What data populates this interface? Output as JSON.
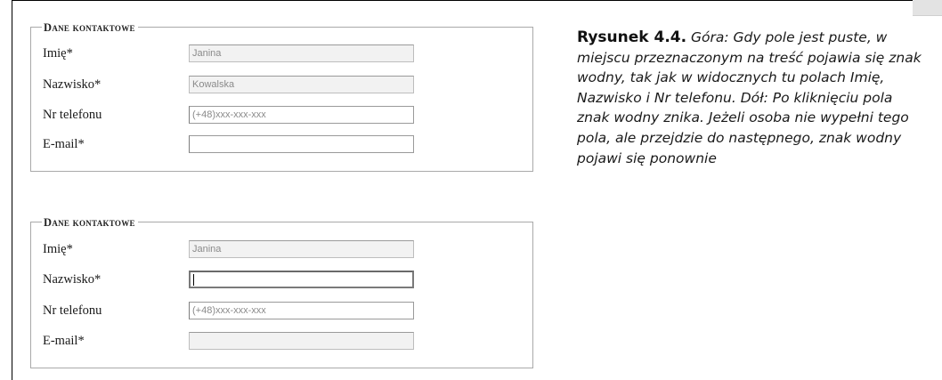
{
  "forms": [
    {
      "legend": "Dane kontaktowe",
      "fields": [
        {
          "label": "Imię*",
          "value": "Janina",
          "state": "watermark"
        },
        {
          "label": "Nazwisko*",
          "value": "Kowalska",
          "state": "watermark"
        },
        {
          "label": "Nr telefonu",
          "value": "(+48)xxx-xxx-xxx",
          "state": "watermark"
        },
        {
          "label": "E-mail*",
          "value": "",
          "state": "empty"
        }
      ]
    },
    {
      "legend": "Dane kontaktowe",
      "fields": [
        {
          "label": "Imię*",
          "value": "Janina",
          "state": "watermark"
        },
        {
          "label": "Nazwisko*",
          "value": "",
          "state": "focused"
        },
        {
          "label": "Nr telefonu",
          "value": "(+48)xxx-xxx-xxx",
          "state": "watermark"
        },
        {
          "label": "E-mail*",
          "value": "",
          "state": "empty"
        }
      ]
    }
  ],
  "caption": {
    "figure_label": "Rysunek 4.4.",
    "text": "Góra: Gdy pole jest puste, w miejscu przeznaczonym na treść pojawia się znak wodny, tak jak w widocznych tu polach Imię, Nazwisko i Nr telefonu. Dół: Po kliknięciu pola znak wodny znika. Jeżeli osoba nie wypełni tego pola, ale przejdzie do następnego, znak wodny pojawi się ponownie"
  }
}
